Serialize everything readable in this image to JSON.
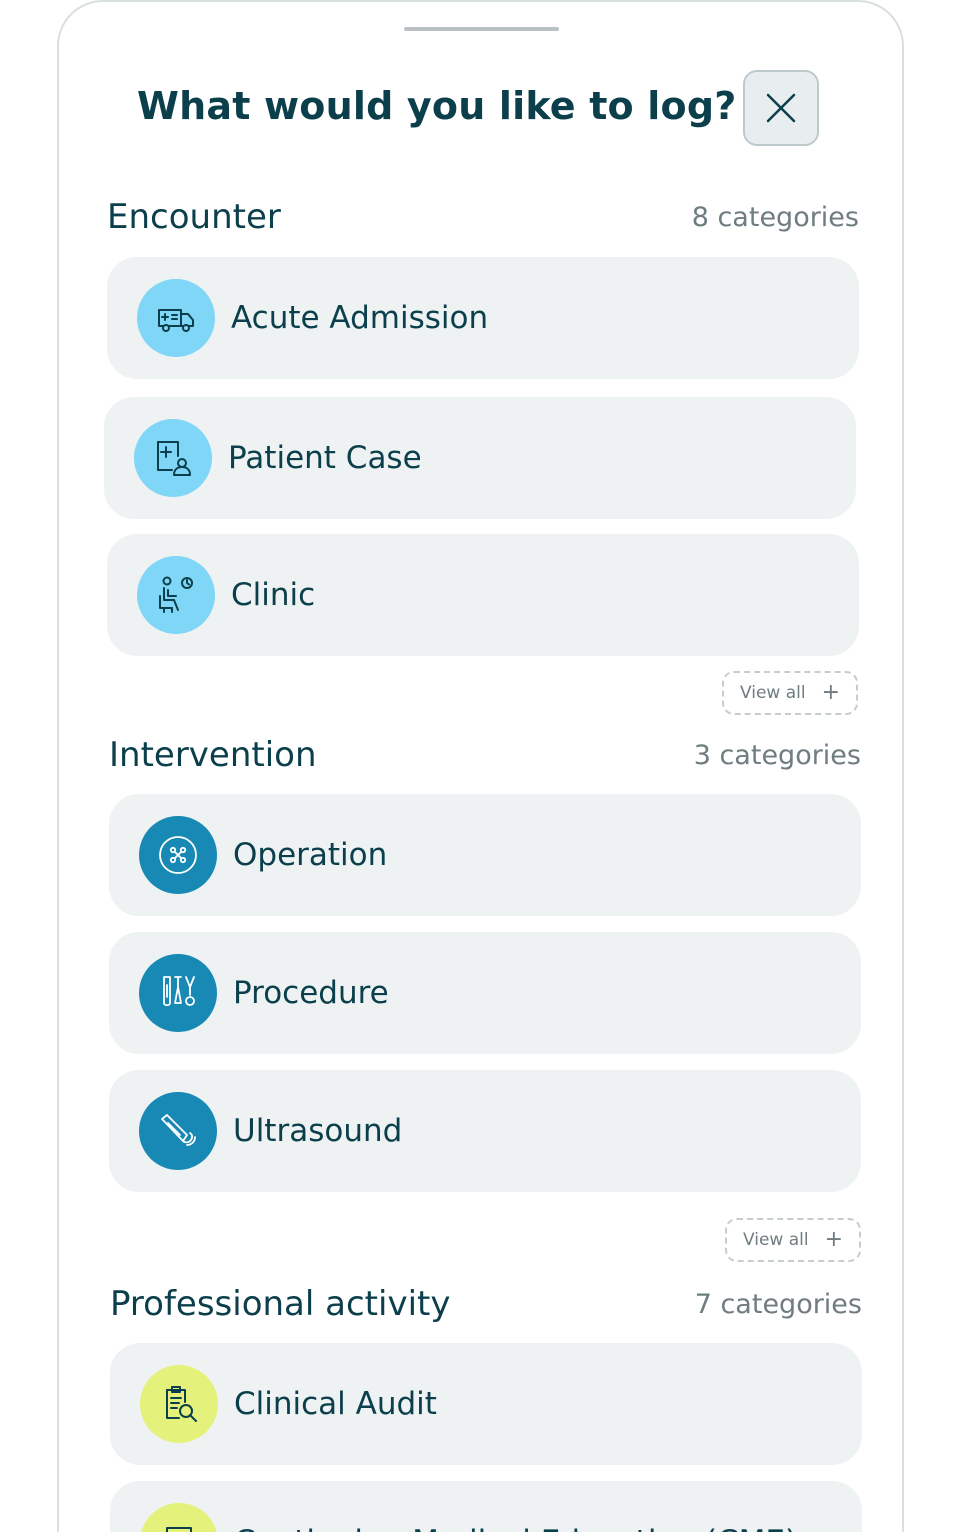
{
  "header": {
    "title": "What would you like to log?"
  },
  "sections": [
    {
      "title": "Encounter",
      "count": "8 categories",
      "items": [
        {
          "label": "Acute Admission",
          "icon": "ambulance-icon"
        },
        {
          "label": "Patient Case",
          "icon": "patient-case-icon"
        },
        {
          "label": "Clinic",
          "icon": "clinic-icon"
        }
      ],
      "view_all": "View all"
    },
    {
      "title": "Intervention",
      "count": "3 categories",
      "items": [
        {
          "label": "Operation",
          "icon": "operation-icon"
        },
        {
          "label": "Procedure",
          "icon": "procedure-icon"
        },
        {
          "label": "Ultrasound",
          "icon": "ultrasound-icon"
        }
      ],
      "view_all": "View all"
    },
    {
      "title": "Professional activity",
      "count": "7 categories",
      "items": [
        {
          "label": "Clinical Audit",
          "icon": "clinical-audit-icon"
        },
        {
          "label": "Continuing Medical Education (CME)",
          "icon": "cme-icon"
        }
      ]
    }
  ],
  "colors": {
    "text_dark": "#0b3f4b",
    "muted": "#6f7c80",
    "card_bg": "#eef2f3",
    "icon_light_blue": "#7fd6f6",
    "icon_dark_blue": "#1789b4",
    "icon_lime": "#e4f27c"
  }
}
